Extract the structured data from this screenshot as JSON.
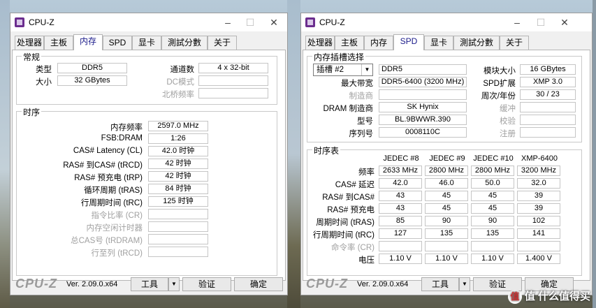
{
  "left": {
    "title": "CPU-Z",
    "tabs": [
      "处理器",
      "主板",
      "内存",
      "SPD",
      "显卡",
      "測試分數",
      "关于"
    ],
    "general": {
      "title": "常规",
      "type_label": "类型",
      "type": "DDR5",
      "size_label": "大小",
      "size": "32 GBytes",
      "channels_label": "通道数",
      "channels": "4 x 32-bit",
      "dc_label": "DC模式",
      "dc": "",
      "nb_label": "北桥频率",
      "nb": ""
    },
    "timings": {
      "title": "时序",
      "rows": [
        {
          "label": "内存频率",
          "value": "2597.0 MHz",
          "dim": false
        },
        {
          "label": "FSB:DRAM",
          "value": "1:26",
          "dim": false
        },
        {
          "label": "CAS# Latency (CL)",
          "value": "42.0 时钟",
          "dim": false
        },
        {
          "label": "RAS# 到CAS# (tRCD)",
          "value": "42 时钟",
          "dim": false
        },
        {
          "label": "RAS# 预充电 (tRP)",
          "value": "42 时钟",
          "dim": false
        },
        {
          "label": "循环周期 (tRAS)",
          "value": "84 时钟",
          "dim": false
        },
        {
          "label": "行周期时间 (tRC)",
          "value": "125 时钟",
          "dim": false
        },
        {
          "label": "指令比率 (CR)",
          "value": "",
          "dim": true
        },
        {
          "label": "内存空闲计时器",
          "value": "",
          "dim": true
        },
        {
          "label": "总CAS号 (tRDRAM)",
          "value": "",
          "dim": true
        },
        {
          "label": "行至列 (tRCD)",
          "value": "",
          "dim": true
        }
      ]
    },
    "footer": {
      "logo": "CPU-Z",
      "version": "Ver. 2.09.0.x64",
      "tools": "工具",
      "validate": "验证",
      "ok": "确定"
    }
  },
  "right": {
    "title": "CPU-Z",
    "tabs": [
      "处理器",
      "主板",
      "内存",
      "SPD",
      "显卡",
      "測試分數",
      "关于"
    ],
    "slot": {
      "title": "内存插槽选择",
      "select": "插槽 #2",
      "type": "DDR5",
      "max_bw_label": "最大带宽",
      "max_bw": "DDR5-6400 (3200 MHz)",
      "mfr_label": "制造商",
      "mfr": "",
      "dram_mfr_label": "DRAM 制造商",
      "dram_mfr": "SK Hynix",
      "part_label": "型号",
      "part": "BL.9BWWR.390",
      "serial_label": "序列号",
      "serial": "0008110C",
      "module_size_label": "模块大小",
      "module_size": "16 GBytes",
      "spd_ext_label": "SPD扩展",
      "spd_ext": "XMP 3.0",
      "week_label": "周次/年份",
      "week": "30 / 23",
      "buffer_label": "缓冲",
      "buffer": "",
      "check_label": "校验",
      "check": "",
      "reg_label": "注册",
      "reg": ""
    },
    "timing_table": {
      "title": "时序表",
      "headers": [
        "JEDEC #8",
        "JEDEC #9",
        "JEDEC #10",
        "XMP-6400"
      ],
      "rows": [
        {
          "label": "频率",
          "dim": false,
          "values": [
            "2633 MHz",
            "2800 MHz",
            "2800 MHz",
            "3200 MHz"
          ]
        },
        {
          "label": "CAS# 延迟",
          "dim": false,
          "values": [
            "42.0",
            "46.0",
            "50.0",
            "32.0"
          ]
        },
        {
          "label": "RAS# 到CAS#",
          "dim": false,
          "values": [
            "43",
            "45",
            "45",
            "39"
          ]
        },
        {
          "label": "RAS# 预充电",
          "dim": false,
          "values": [
            "43",
            "45",
            "45",
            "39"
          ]
        },
        {
          "label": "周期时间 (tRAS)",
          "dim": false,
          "values": [
            "85",
            "90",
            "90",
            "102"
          ]
        },
        {
          "label": "行周期时间 (tRC)",
          "dim": false,
          "values": [
            "127",
            "135",
            "135",
            "141"
          ]
        },
        {
          "label": "命令率 (CR)",
          "dim": true,
          "values": [
            "",
            "",
            "",
            ""
          ]
        },
        {
          "label": "电压",
          "dim": false,
          "values": [
            "1.10 V",
            "1.10 V",
            "1.10 V",
            "1.400 V"
          ]
        }
      ]
    },
    "footer": {
      "logo": "CPU-Z",
      "version": "Ver. 2.09.0.x64",
      "tools": "工具",
      "validate": "验证",
      "ok": "确定"
    }
  },
  "watermark": "值 什么值得买"
}
